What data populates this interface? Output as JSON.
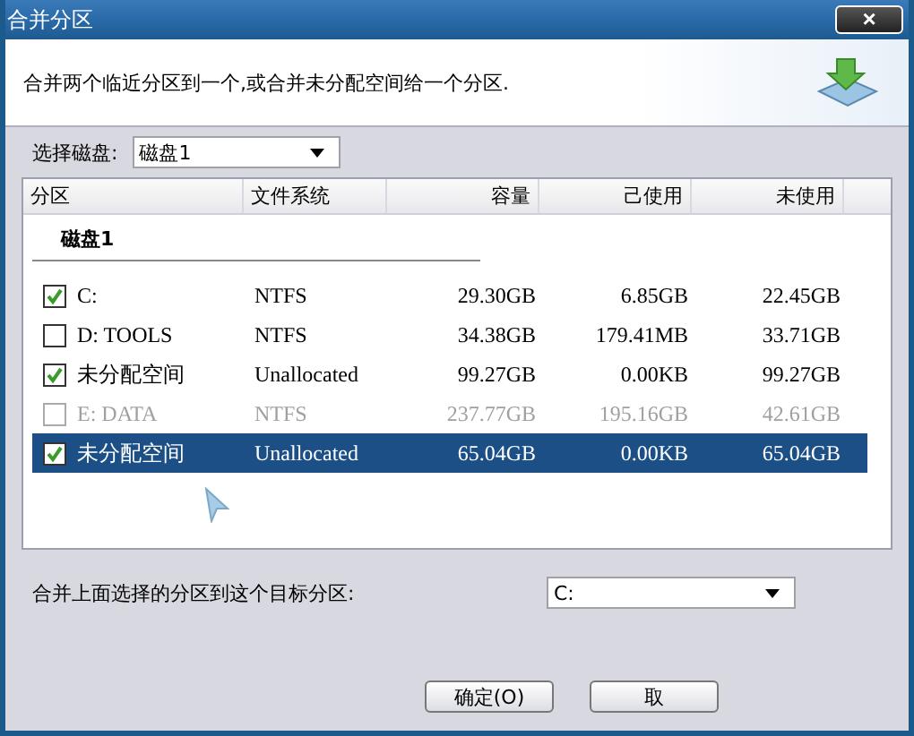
{
  "window": {
    "title": "合并分区",
    "close": "×"
  },
  "description": "合并两个临近分区到一个,或合并未分配空间给一个分区.",
  "disk_select": {
    "label": "选择磁盘:",
    "value": "磁盘1"
  },
  "table": {
    "columns": [
      "分区",
      "文件系统",
      "容量",
      "己使用",
      "未使用"
    ],
    "group": "磁盘1",
    "rows": [
      {
        "cells": [
          "C:",
          "NTFS",
          "29.30GB",
          "6.85GB",
          "22.45GB"
        ],
        "checked": true,
        "disabled": false,
        "selected": false
      },
      {
        "cells": [
          "D:  TOOLS",
          "NTFS",
          "34.38GB",
          "179.41MB",
          "33.71GB"
        ],
        "checked": false,
        "disabled": false,
        "selected": false
      },
      {
        "cells": [
          "未分配空间",
          "Unallocated",
          "99.27GB",
          "0.00KB",
          "99.27GB"
        ],
        "checked": true,
        "disabled": false,
        "selected": false
      },
      {
        "cells": [
          "E:  DATA",
          "NTFS",
          "237.77GB",
          "195.16GB",
          "42.61GB"
        ],
        "checked": false,
        "disabled": true,
        "selected": false
      },
      {
        "cells": [
          "未分配空间",
          "Unallocated",
          "65.04GB",
          "0.00KB",
          "65.04GB"
        ],
        "checked": true,
        "disabled": false,
        "selected": true
      }
    ]
  },
  "target": {
    "label": "合并上面选择的分区到这个目标分区:",
    "value": "C:"
  },
  "buttons": [
    "确定(O)",
    "取"
  ]
}
